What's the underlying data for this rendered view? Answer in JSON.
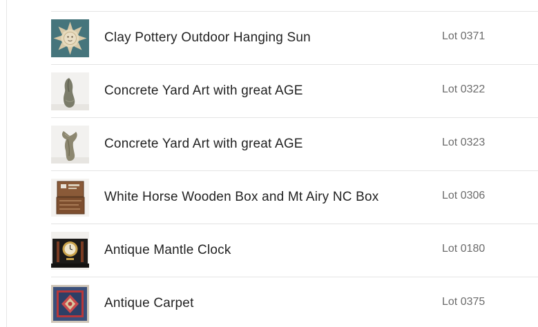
{
  "lots": [
    {
      "title": "Clay Pottery Outdoor Hanging Sun",
      "lot": "Lot 0371",
      "thumb_icon": "hanging-sun-thumbnail"
    },
    {
      "title": "Concrete Yard Art with great AGE",
      "lot": "Lot 0322",
      "thumb_icon": "concrete-statue-thumbnail"
    },
    {
      "title": "Concrete Yard Art with great AGE",
      "lot": "Lot 0323",
      "thumb_icon": "concrete-statue-thumbnail"
    },
    {
      "title": "White Horse Wooden Box and Mt Airy NC Box",
      "lot": "Lot 0306",
      "thumb_icon": "wooden-box-thumbnail"
    },
    {
      "title": "Antique Mantle Clock",
      "lot": "Lot 0180",
      "thumb_icon": "mantle-clock-thumbnail"
    },
    {
      "title": "Antique Carpet",
      "lot": "Lot 0375",
      "thumb_icon": "carpet-thumbnail"
    }
  ]
}
